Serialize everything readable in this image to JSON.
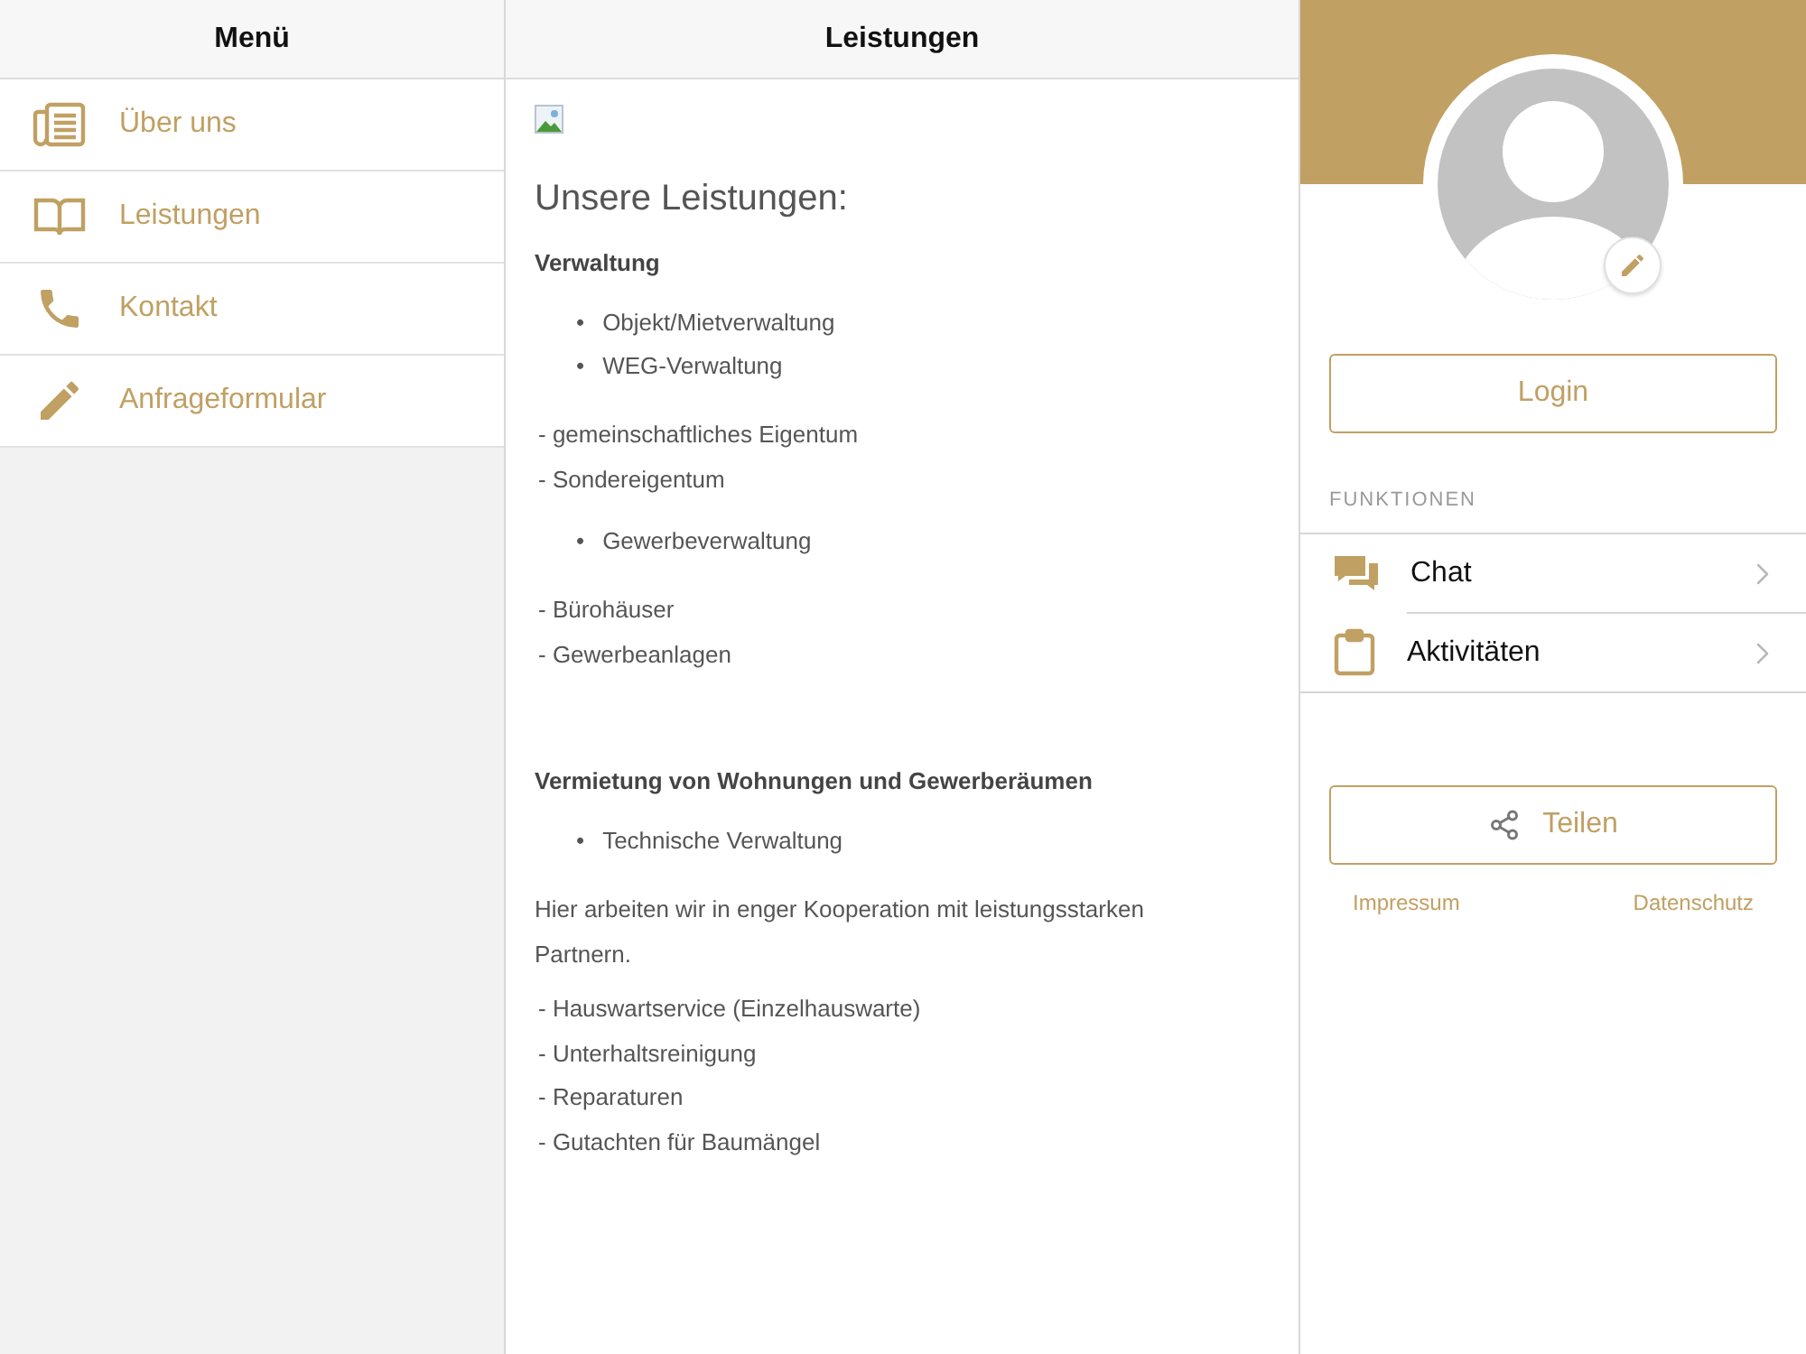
{
  "menu": {
    "title": "Menü",
    "items": [
      {
        "label": "Über uns"
      },
      {
        "label": "Leistungen"
      },
      {
        "label": "Kontakt"
      },
      {
        "label": "Anfrageformular"
      }
    ]
  },
  "content": {
    "title": "Leistungen",
    "blocks": [
      {
        "kind": "image"
      },
      {
        "kind": "title",
        "text": "Unsere Leistungen:"
      },
      {
        "kind": "section",
        "text": "Verwaltung"
      },
      {
        "kind": "bullets",
        "marker": "•",
        "items": [
          "Objekt/Mietverwaltung",
          "WEG-Verwaltung"
        ]
      },
      {
        "kind": "lines",
        "items": [
          "- gemeinschaftliches Eigentum",
          "- Sondereigentum"
        ]
      },
      {
        "kind": "bullets",
        "marker": "•",
        "items": [
          "Gewerbeverwaltung"
        ]
      },
      {
        "kind": "lines",
        "items": [
          "- Bürohäuser",
          "- Gewerbeanlagen"
        ]
      },
      {
        "kind": "section",
        "text": "Vermietung von Wohnungen und Gewerberäumen"
      },
      {
        "kind": "bullets",
        "marker": "•",
        "items": [
          "Technische Verwaltung"
        ]
      },
      {
        "kind": "paragraph",
        "text": "Hier arbeiten wir in enger Kooperation mit leistungsstarken Partnern."
      },
      {
        "kind": "lines",
        "items": [
          "- Hauswartservice (Einzelhauswarte)",
          "- Unterhaltsreinigung",
          "- Reparaturen",
          "- Gutachten für Baumängel"
        ]
      }
    ]
  },
  "profile": {
    "login": "Login",
    "section_label": "FUNKTIONEN",
    "functions": [
      {
        "label": "Chat"
      },
      {
        "label": "Aktivitäten"
      }
    ],
    "share": "Teilen",
    "links": [
      "Impressum",
      "Datenschutz"
    ]
  }
}
